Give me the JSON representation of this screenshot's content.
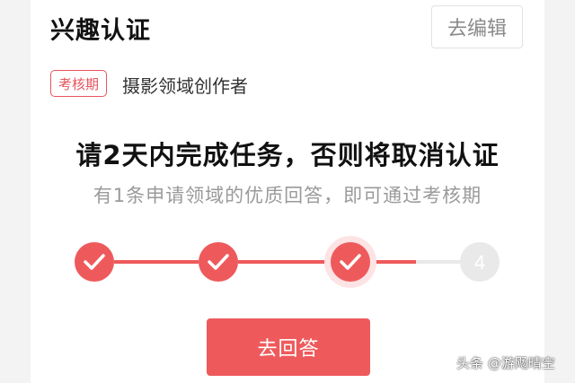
{
  "header": {
    "title": "兴趣认证",
    "edit_label": "去编辑"
  },
  "status": {
    "badge": "考核期",
    "domain": "摄影领域创作者"
  },
  "task": {
    "heading": "请2天内完成任务，否则将取消认证",
    "description": "有1条申请领域的优质回答，即可通过考核期"
  },
  "progress": {
    "steps": [
      {
        "state": "done",
        "label": ""
      },
      {
        "state": "done",
        "label": ""
      },
      {
        "state": "current",
        "label": ""
      },
      {
        "state": "pending",
        "label": "4"
      }
    ],
    "connector_fill": [
      1,
      1,
      0.5
    ],
    "colors": {
      "active": "#ee5a5c",
      "inactive": "#e9e9e9",
      "current_ring": "#fde3e3"
    }
  },
  "action": {
    "label": "去回答"
  },
  "watermark": {
    "text": "头条 @游飏晴空"
  }
}
